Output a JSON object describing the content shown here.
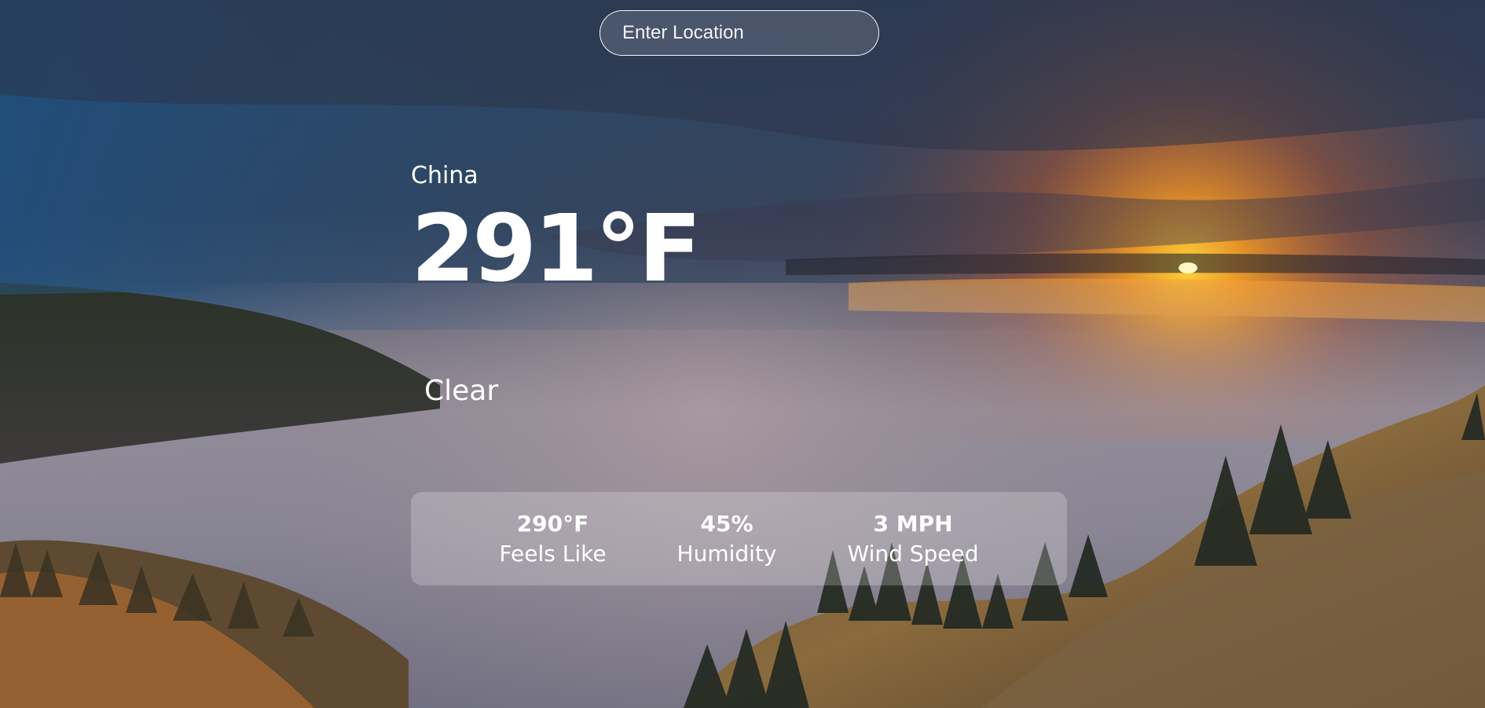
{
  "search": {
    "placeholder": "Enter Location",
    "value": ""
  },
  "weather": {
    "location": "China",
    "temperature": "291°F",
    "condition": "Clear"
  },
  "stats": [
    {
      "value": "290°F",
      "label": "Feels Like"
    },
    {
      "value": "45%",
      "label": "Humidity"
    },
    {
      "value": "3 MPH",
      "label": "Wind Speed"
    }
  ],
  "background": {
    "subject": "sunset over fog-covered forested mountains",
    "colors": {
      "sky_top": "#1f3c5e",
      "sky_dark": "#2f3a50",
      "sunset_orange": "#f08a1c",
      "fog": "#8d8fa0",
      "forest": "#2c3026",
      "hillside": "#8a6a3e"
    }
  }
}
